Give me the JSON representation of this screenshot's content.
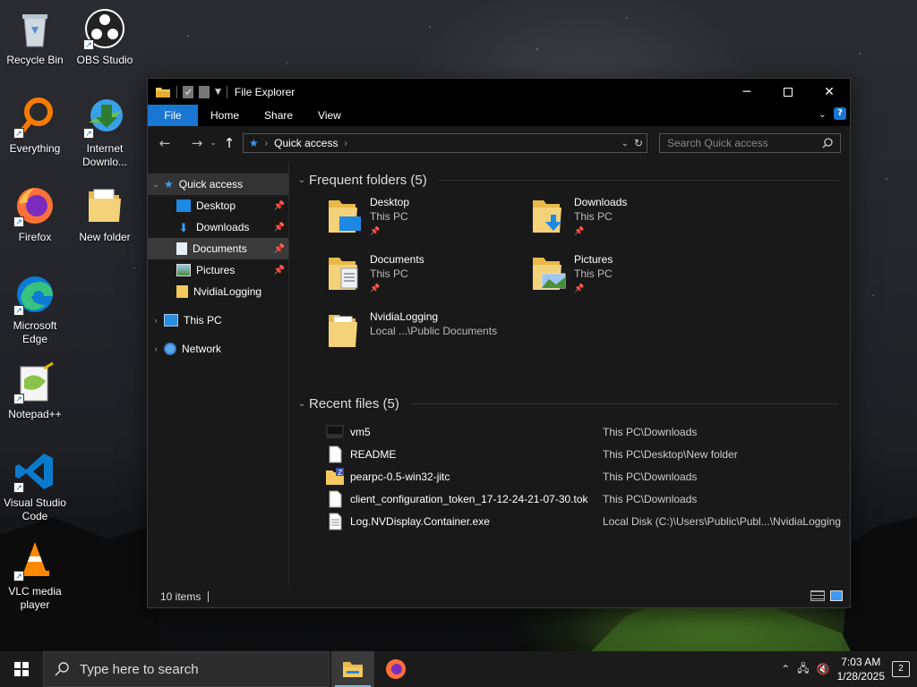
{
  "desktop": {
    "icons": [
      {
        "label": "Recycle Bin",
        "icon": "recycle-bin-icon"
      },
      {
        "label": "OBS Studio",
        "icon": "obs-icon"
      },
      {
        "label": "Everything",
        "icon": "search-magnifier-icon"
      },
      {
        "label": "Internet Downlo...",
        "icon": "idm-icon"
      },
      {
        "label": "Firefox",
        "icon": "firefox-icon"
      },
      {
        "label": "New folder",
        "icon": "folder-icon"
      },
      {
        "label": "Microsoft Edge",
        "icon": "edge-icon"
      },
      {
        "label": "Notepad++",
        "icon": "notepadpp-icon"
      },
      {
        "label": "Visual Studio Code",
        "icon": "vscode-icon"
      },
      {
        "label": "VLC media player",
        "icon": "vlc-icon"
      }
    ]
  },
  "window": {
    "title": "File Explorer",
    "tabs": [
      "File",
      "Home",
      "Share",
      "View"
    ],
    "address": {
      "location": "Quick access"
    },
    "search": {
      "placeholder": "Search Quick access"
    },
    "nav": {
      "quick_access": "Quick access",
      "items": [
        "Desktop",
        "Downloads",
        "Documents",
        "Pictures",
        "NvidiaLogging"
      ],
      "this_pc": "This PC",
      "network": "Network"
    },
    "frequent": {
      "heading": "Frequent folders (5)",
      "folders": [
        {
          "name": "Desktop",
          "location": "This PC"
        },
        {
          "name": "Downloads",
          "location": "This PC"
        },
        {
          "name": "Documents",
          "location": "This PC"
        },
        {
          "name": "Pictures",
          "location": "This PC"
        },
        {
          "name": "NvidiaLogging",
          "location": "Local ...\\Public Documents"
        }
      ]
    },
    "recent": {
      "heading": "Recent files (5)",
      "files": [
        {
          "name": "vm5",
          "path": "This PC\\Downloads"
        },
        {
          "name": "README",
          "path": "This PC\\Desktop\\New folder"
        },
        {
          "name": "pearpc-0.5-win32-jitc",
          "path": "This PC\\Downloads"
        },
        {
          "name": "client_configuration_token_17-12-24-21-07-30.tok",
          "path": "This PC\\Downloads"
        },
        {
          "name": "Log.NVDisplay.Container.exe",
          "path": "Local Disk (C:)\\Users\\Public\\Publ...\\NvidiaLogging"
        }
      ]
    },
    "status": "10 items"
  },
  "taskbar": {
    "search_placeholder": "Type here to search",
    "time": "7:03 AM",
    "date": "1/28/2025",
    "notification_count": "2"
  },
  "colors": {
    "accent": "#1976d2",
    "folder": "#f4c95d",
    "window_bg": "#191919"
  }
}
